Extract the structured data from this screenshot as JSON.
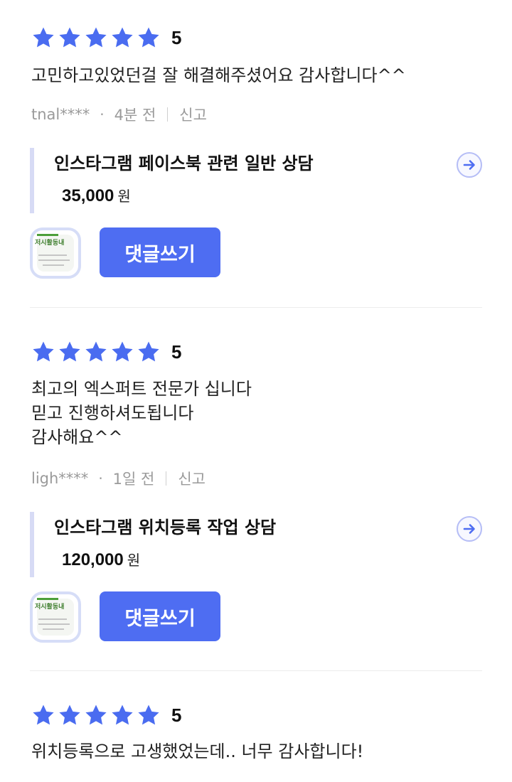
{
  "icons": {
    "star": "star-icon",
    "arrow": "arrow-right-circle-icon",
    "thumb": "service-thumbnail-logo"
  },
  "colors": {
    "star": "#4a6cf0",
    "button": "#4e6df2",
    "accent_bar": "#d7dbf5",
    "meta_text": "#9a9a9a"
  },
  "reviews": [
    {
      "rating": 5,
      "score_label": "5",
      "content": "고민하고있었던걸 잘 해결해주셨어요 감사합니다^^",
      "author": "tnal****",
      "time": "4분 전",
      "report": "신고",
      "service_title": "인스타그램 페이스북 관련 일반 상담",
      "price": "35,000",
      "price_unit": "원",
      "thumb_text": "저시활동내",
      "reply_label": "댓글쓰기"
    },
    {
      "rating": 5,
      "score_label": "5",
      "content": "최고의 엑스퍼트 전문가 십니다\n믿고 진행하셔도됩니다\n감사해요^^",
      "author": "ligh****",
      "time": "1일 전",
      "report": "신고",
      "service_title": "인스타그램 위치등록 작업 상담",
      "price": "120,000",
      "price_unit": "원",
      "thumb_text": "저시활동내",
      "reply_label": "댓글쓰기"
    },
    {
      "rating": 5,
      "score_label": "5",
      "content": "위치등록으로 고생했었는데.. 너무 감사합니다!"
    }
  ]
}
